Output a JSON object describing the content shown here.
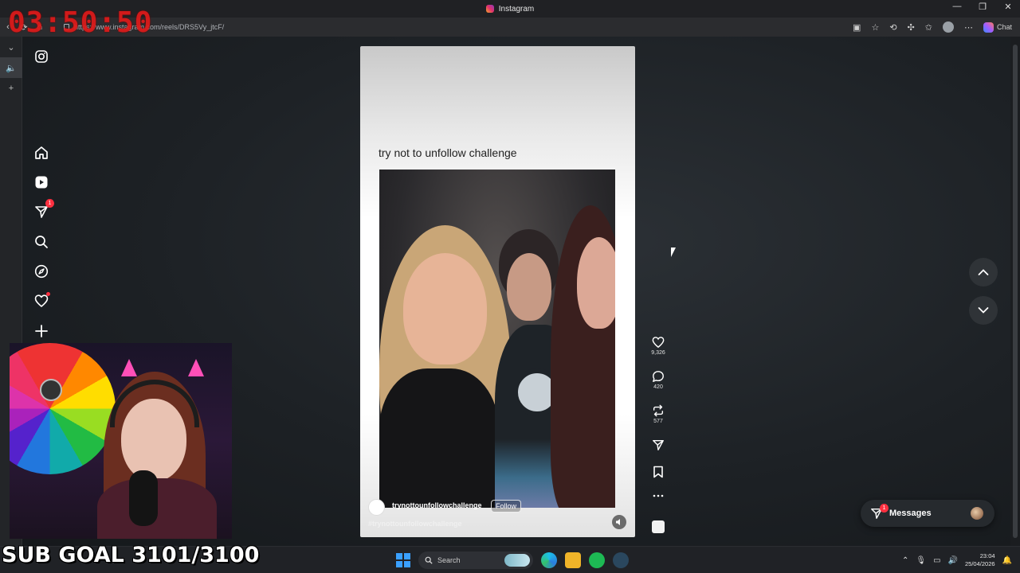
{
  "window": {
    "title": "Instagram",
    "controls": [
      "—",
      "❐",
      "✕"
    ]
  },
  "address_bar": {
    "url": "https://www.instagram.com/reels/DRS5Vy_jtcF/",
    "chat_label": "Chat"
  },
  "overlay": {
    "timer": "03:50:50",
    "sub_goal": "SUB GOAL 3101/3100"
  },
  "ig_nav": {
    "items": [
      {
        "name": "instagram-logo-icon"
      },
      {
        "name": "home-icon"
      },
      {
        "name": "reels-icon"
      },
      {
        "name": "messages-icon",
        "badge": "1"
      },
      {
        "name": "search-icon"
      },
      {
        "name": "explore-icon"
      },
      {
        "name": "notifications-icon"
      },
      {
        "name": "create-icon"
      }
    ]
  },
  "reel": {
    "caption": "try not to unfollow challenge",
    "account": "trynottounfollowchallenge",
    "follow_label": "Follow",
    "hashtag": "#trynottounfollowchallenge"
  },
  "actions": {
    "likes": "9,326",
    "comments": "420",
    "reposts": "577"
  },
  "messages_pill": {
    "label": "Messages",
    "badge": "1"
  },
  "taskbar": {
    "search_placeholder": "Search",
    "time": "23:04",
    "date": "25/04/2026"
  },
  "colors": {
    "badge": "#ff3040",
    "timer": "#e01a1a",
    "accent": "#3aa0ff"
  }
}
